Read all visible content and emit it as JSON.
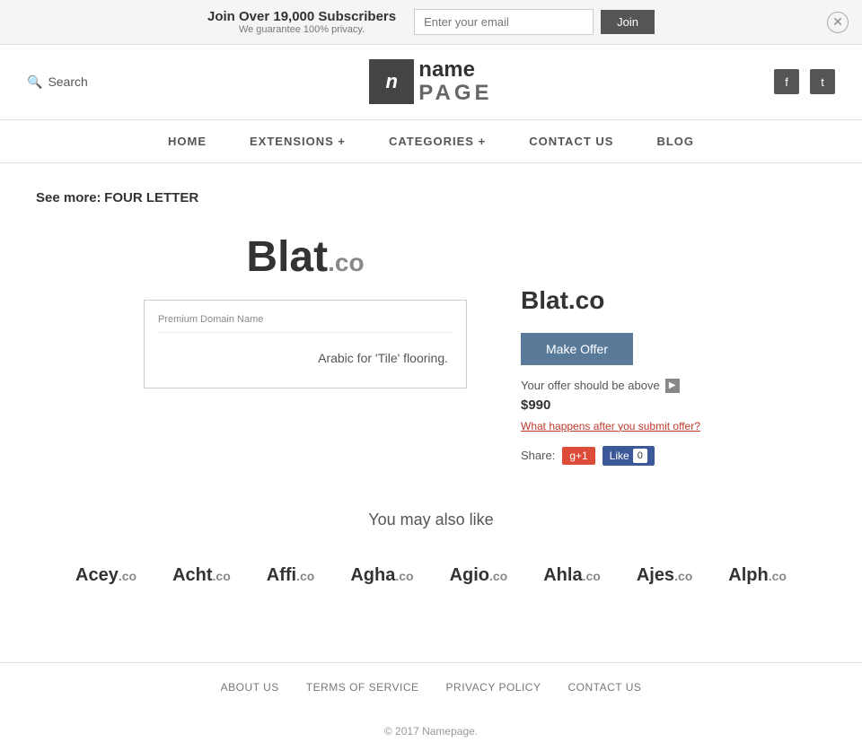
{
  "banner": {
    "headline": "Join Over 19,000 Subscribers",
    "subtext": "We guarantee 100% privacy.",
    "email_placeholder": "Enter your email",
    "join_label": "Join"
  },
  "header": {
    "search_label": "Search",
    "logo_letter": "n",
    "logo_name": "name",
    "logo_page": "PAGE",
    "facebook_icon": "f",
    "twitter_icon": "t"
  },
  "nav": {
    "items": [
      {
        "label": "HOME"
      },
      {
        "label": "EXTENSIONS +"
      },
      {
        "label": "CATEGORIES +"
      },
      {
        "label": "CONTACT US"
      },
      {
        "label": "BLOG"
      }
    ]
  },
  "breadcrumb": {
    "see_more_label": "See more:",
    "category": "FOUR LETTER"
  },
  "domain": {
    "name": "Blat",
    "tld": ".co",
    "full": "Blat.co",
    "info_label": "Premium Domain Name",
    "description": "Arabic for 'Tile' flooring.",
    "make_offer_label": "Make Offer",
    "offer_text": "Your offer should be above",
    "offer_price": "$990",
    "offer_question": "What happens after you submit offer?",
    "share_label": "Share:",
    "g_plus_label": "g+1",
    "fb_like_label": "Like",
    "fb_count": "0"
  },
  "also_like": {
    "title": "You may also like",
    "domains": [
      {
        "name": "Acey",
        "tld": ".co"
      },
      {
        "name": "Acht",
        "tld": ".co"
      },
      {
        "name": "Affi",
        "tld": ".co"
      },
      {
        "name": "Agha",
        "tld": ".co"
      },
      {
        "name": "Agio",
        "tld": ".co"
      },
      {
        "name": "Ahla",
        "tld": ".co"
      },
      {
        "name": "Ajes",
        "tld": ".co"
      },
      {
        "name": "Alph",
        "tld": ".co"
      }
    ]
  },
  "footer": {
    "links": [
      {
        "label": "ABOUT US"
      },
      {
        "label": "TERMS OF SERVICE"
      },
      {
        "label": "PRIVACY POLICY"
      },
      {
        "label": "CONTACT US"
      }
    ],
    "copyright": "© 2017 Namepage."
  }
}
